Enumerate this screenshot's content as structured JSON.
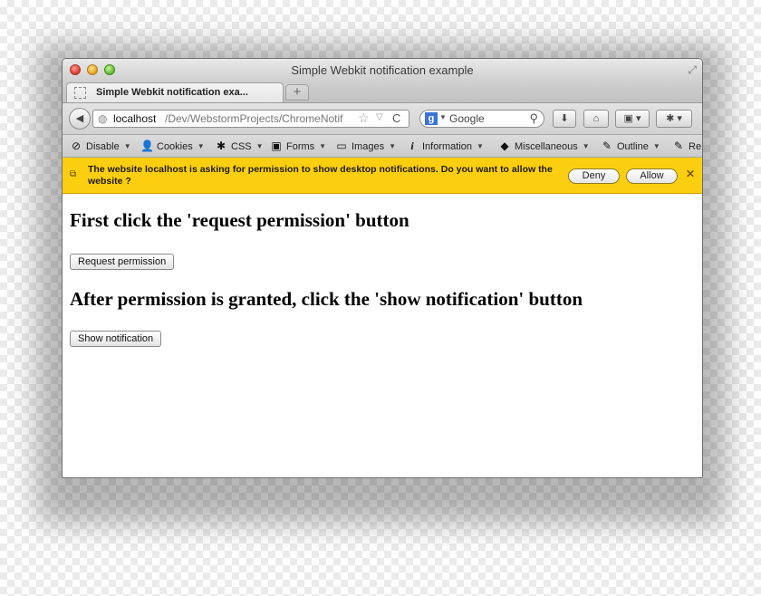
{
  "window": {
    "title": "Simple Webkit notification example"
  },
  "tabs": [
    {
      "label": "Simple Webkit notification exa..."
    }
  ],
  "newtab": {
    "label": "+"
  },
  "nav": {
    "back_glyph": "◀",
    "url_host": "localhost",
    "url_path": "/Dev/WebstormProjects/ChromeNotif",
    "reload_glyph": "C",
    "search_placeholder": "Google",
    "search_engine": "g"
  },
  "devtoolbar": {
    "items": [
      {
        "icon": "disable-icon",
        "glyph": "⊘",
        "label": "Disable"
      },
      {
        "icon": "user-icon",
        "glyph": "👤",
        "label": "Cookies"
      },
      {
        "icon": "wand-icon",
        "glyph": "✱",
        "label": "CSS"
      },
      {
        "icon": "clipboard-icon",
        "glyph": "▣",
        "label": "Forms"
      },
      {
        "icon": "image-icon",
        "glyph": "▭",
        "label": "Images"
      },
      {
        "icon": "info-icon",
        "glyph": "i",
        "label": "Information"
      },
      {
        "icon": "cube-icon",
        "glyph": "◆",
        "label": "Miscellaneous"
      },
      {
        "icon": "pencil-icon",
        "glyph": "✎",
        "label": "Outline"
      },
      {
        "icon": "pencil-icon",
        "glyph": "✎",
        "label": "Re"
      }
    ]
  },
  "notification": {
    "text": "The website localhost is asking for permission to show desktop notifications. Do you want to allow the website ?",
    "deny_label": "Deny",
    "allow_label": "Allow",
    "close_glyph": "✕"
  },
  "page": {
    "heading1": "First click the 'request permission' button",
    "request_button": "Request permission",
    "heading2": "After permission is granted, click the 'show notification' button",
    "show_button": "Show notification"
  },
  "colors": {
    "notification_bar": "#fbcf0f",
    "window_frame": "#d0d0d0"
  }
}
